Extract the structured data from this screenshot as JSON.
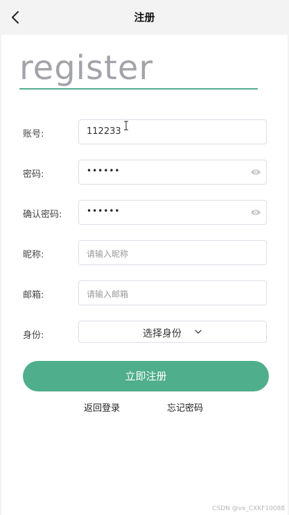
{
  "header": {
    "title": "注册",
    "back_icon": "chevron-left-icon"
  },
  "hero": {
    "text": "register",
    "underline_color": "#4fae8b"
  },
  "form": {
    "account": {
      "label": "账号:",
      "value": "112233"
    },
    "password": {
      "label": "密码:",
      "value": "••••••",
      "icon": "eye-icon"
    },
    "confirm_password": {
      "label": "确认密码:",
      "value": "••••••",
      "icon": "eye-icon"
    },
    "nickname": {
      "label": "昵称:",
      "placeholder": "请输入昵称"
    },
    "email": {
      "label": "邮箱:",
      "placeholder": "请输入邮箱"
    },
    "identity": {
      "label": "身份:",
      "selected": "选择身份",
      "icon": "chevron-down-icon"
    }
  },
  "actions": {
    "register_label": "立即注册",
    "back_to_login": "返回登录",
    "forgot_password": "忘记密码",
    "primary_color": "#4fae8b"
  },
  "watermark": "CSDN @vx_CXKF10088"
}
